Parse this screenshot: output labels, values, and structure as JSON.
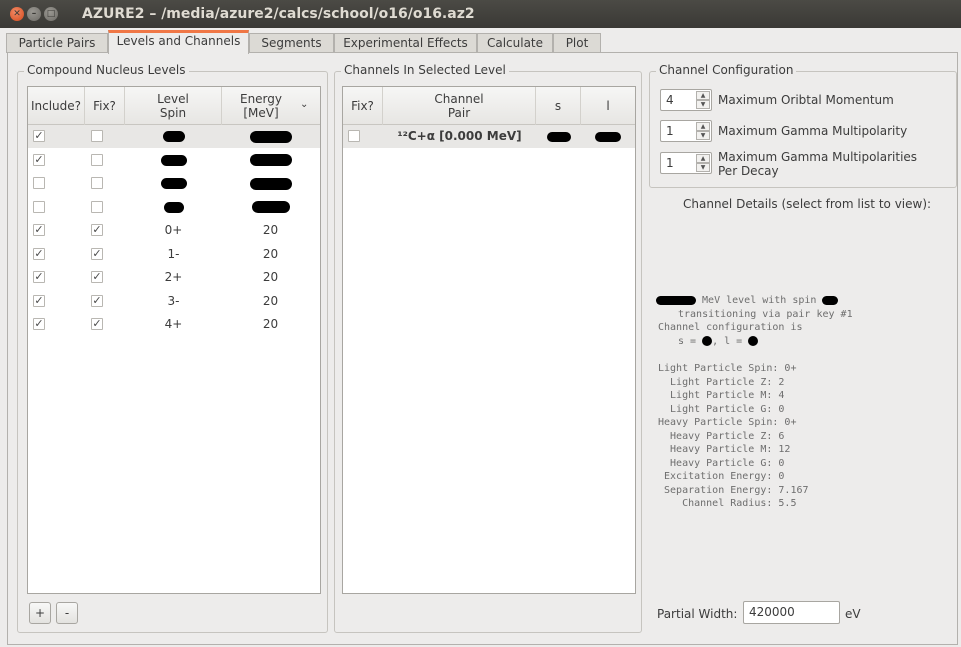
{
  "window": {
    "title": "AZURE2 – /media/azure2/calcs/school/o16/o16.az2"
  },
  "tabs": [
    "Particle Pairs",
    "Levels and Channels",
    "Segments",
    "Experimental Effects",
    "Calculate",
    "Plot"
  ],
  "levels": {
    "group_title": "Compound Nucleus Levels",
    "headers": {
      "include": "Include?",
      "fix": "Fix?",
      "spin": "Level\nSpin",
      "energy": "Energy\n[MeV]"
    },
    "rows": [
      {
        "include": true,
        "fix": false,
        "spin": "",
        "energy": "",
        "spin_redacted": true,
        "energy_redacted": true
      },
      {
        "include": true,
        "fix": false,
        "spin": "",
        "energy": "",
        "spin_redacted": true,
        "energy_redacted": true
      },
      {
        "include": false,
        "fix": false,
        "spin": "",
        "energy": "",
        "spin_redacted": true,
        "energy_redacted": true
      },
      {
        "include": false,
        "fix": false,
        "spin": "",
        "energy": "",
        "spin_redacted": true,
        "energy_redacted": true
      },
      {
        "include": true,
        "fix": true,
        "spin": "0+",
        "energy": "20"
      },
      {
        "include": true,
        "fix": true,
        "spin": "1-",
        "energy": "20"
      },
      {
        "include": true,
        "fix": true,
        "spin": "2+",
        "energy": "20"
      },
      {
        "include": true,
        "fix": true,
        "spin": "3-",
        "energy": "20"
      },
      {
        "include": true,
        "fix": true,
        "spin": "4+",
        "energy": "20"
      }
    ],
    "add_label": "+",
    "remove_label": "-"
  },
  "channels": {
    "group_title": "Channels In Selected Level",
    "headers": {
      "fix": "Fix?",
      "pair": "Channel\nPair",
      "s": "s",
      "l": "l"
    },
    "rows": [
      {
        "fix": false,
        "pair": "¹²C+α [0.000 MeV]",
        "s_redacted": true,
        "l_redacted": true
      }
    ]
  },
  "config": {
    "group_title": "Channel Configuration",
    "max_orbital": {
      "value": "4",
      "label": "Maximum Oribtal Momentum"
    },
    "max_gamma": {
      "value": "1",
      "label": "Maximum Gamma Multipolarity"
    },
    "max_gamma_decay": {
      "value": "1",
      "label": "Maximum Gamma Multipolarities\nPer Decay"
    }
  },
  "details": {
    "title": "Channel Details (select from list to view):",
    "line1": "MeV level with spin",
    "line2": "transitioning via pair key #1",
    "line3": "Channel configuration is",
    "line4_s": "s =",
    "line4_l": ", l =",
    "props": [
      "Light Particle Spin: 0+",
      "  Light Particle Z: 2",
      "  Light Particle M: 4",
      "  Light Particle G: 0",
      "Heavy Particle Spin: 0+",
      "  Heavy Particle Z: 6",
      "  Heavy Particle M: 12",
      "  Heavy Particle G: 0",
      " Excitation Energy: 0",
      " Separation Energy: 7.167",
      "    Channel Radius: 5.5"
    ]
  },
  "partial_width": {
    "label": "Partial Width:",
    "value": "420000",
    "unit": "eV"
  }
}
